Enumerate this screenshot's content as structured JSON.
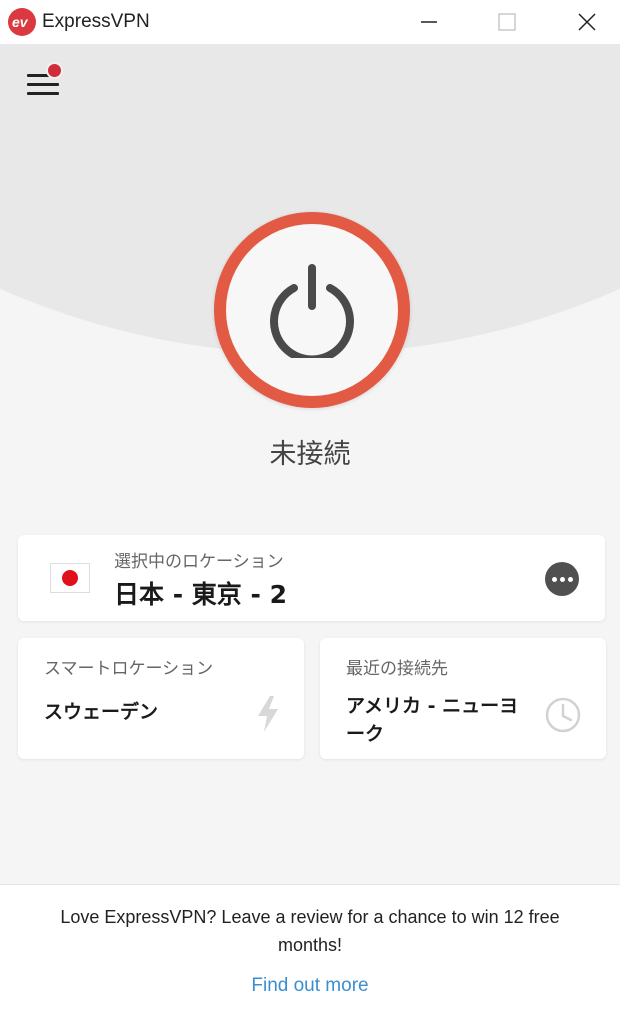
{
  "window": {
    "title": "ExpressVPN",
    "logo_text": "ev"
  },
  "menu": {
    "has_notification": true
  },
  "connection": {
    "status": "未接続"
  },
  "selected_location": {
    "label": "選択中のロケーション",
    "value": "日本 - 東京 - 2",
    "flag": "japan"
  },
  "smart_location": {
    "label": "スマートロケーション",
    "value": "スウェーデン"
  },
  "recent_location": {
    "label": "最近の接続先",
    "value": "アメリカ - ニューヨーク"
  },
  "footer": {
    "message": "Love ExpressVPN? Leave a review for a chance to win 12 free months!",
    "link": "Find out more"
  },
  "colors": {
    "brand_red": "#da3940",
    "power_ring": "#e35a44",
    "link_blue": "#3b8fd0"
  },
  "icons": {
    "menu": "hamburger-icon",
    "power": "power-icon",
    "more": "more-options-icon",
    "smart": "lightning-icon",
    "recent": "clock-icon"
  }
}
